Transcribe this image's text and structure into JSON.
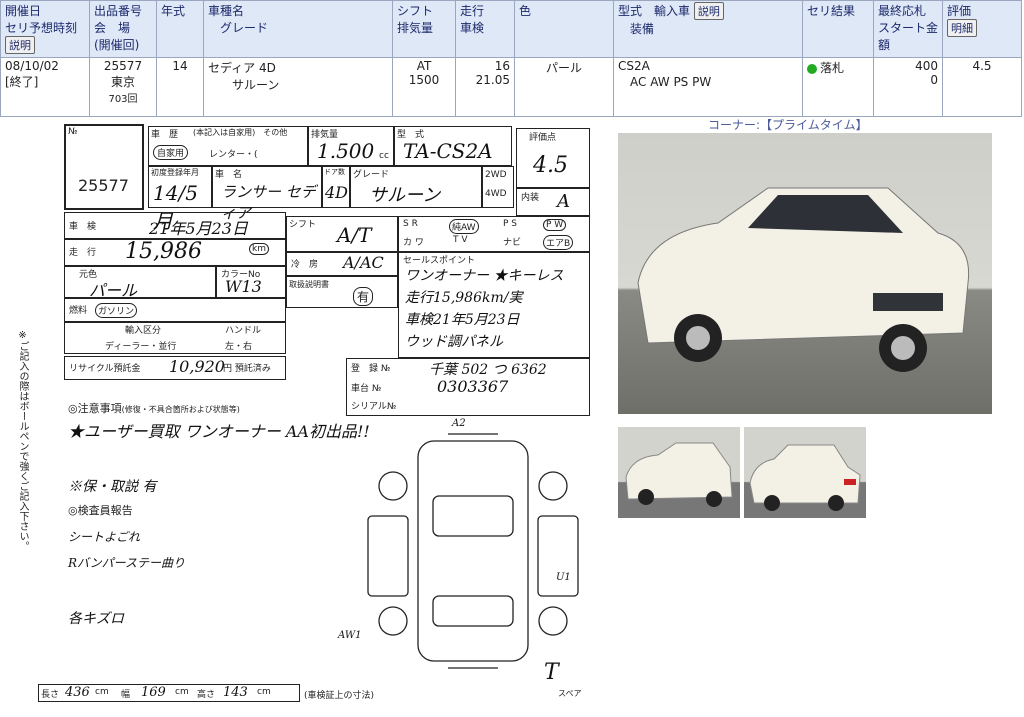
{
  "header": {
    "cols": [
      {
        "l1": "開催日",
        "l2": "セリ予想時刻",
        "btn": "説明"
      },
      {
        "l1": "出品番号",
        "l2": "会　場",
        "l3": "(開催回)"
      },
      {
        "l1": "年式"
      },
      {
        "l1": "車種名",
        "l2": "グレード"
      },
      {
        "l1": "シフト",
        "l2": "排気量"
      },
      {
        "l1": "走行",
        "l2": "車検"
      },
      {
        "l1": "色"
      },
      {
        "l1": "型式　輸入車",
        "btn": "説明",
        "l2": "装備"
      },
      {
        "l1": "セリ結果"
      },
      {
        "l1": "最終応札",
        "l2": "スタート金額"
      },
      {
        "l1": "評価",
        "btn": "明細"
      }
    ],
    "row": {
      "date": "08/10/02",
      "status": "[終了]",
      "lot": "25577",
      "venue": "東京",
      "session": "703回",
      "year": "14",
      "model": "セディア 4D",
      "grade": "サルーン",
      "shift": "AT",
      "cc": "1500",
      "mileage": "16",
      "inspection": "21.05",
      "color": "パール",
      "type": "CS2A",
      "equip": "AC AW PS PW",
      "result": "落札",
      "final": "400",
      "start": "0",
      "grade_score": "4.5"
    }
  },
  "corner_label": "コーナー:【プライムタイム】",
  "sheet": {
    "lot_label": "№",
    "lot": "25577",
    "history": "車　歴",
    "history_sub": "(本記入は自家用)　その他",
    "history_val": "自家用",
    "rental": "レンター・(",
    "cc_label": "排気量",
    "cc_val": "1.500",
    "cc_note": "cc",
    "type_label": "型　式",
    "type_val": "TA-CS2A",
    "score_label": "評価点",
    "score_val": "4.5",
    "first_reg": "初度登録年月",
    "first_reg_val": "14/5月",
    "name_label": "車　名",
    "name_val": "ランサー セディア",
    "door_label": "ドア数",
    "door_val": "4D",
    "grade_label": "グレード",
    "grade_val": "サルーン",
    "drive": "2WD",
    "drive2": "4WD",
    "interior_label": "内装",
    "interior_val": "A",
    "shaken": "車　検",
    "shaken_val": "21年5月23日",
    "odo": "走　行",
    "odo_val": "15,986",
    "odo_unit": "km",
    "shift_label": "シフト",
    "shift_val": "A/T",
    "equip_row1": [
      "S R",
      "純AW",
      "P S",
      "P W"
    ],
    "equip_row2": [
      "カ ワ",
      "T V",
      "ナビ",
      "エアB"
    ],
    "ac_label": "冷　房",
    "ac_val": "A/AC",
    "color_label": "元色",
    "color_val": "パール",
    "colorno_label": "カラーNo",
    "colorno_val": "W13",
    "fuel_label": "燃料",
    "fuel_val": "ガソリン",
    "manual_label": "取扱説明書",
    "manual_val": "有",
    "import_label": "輸入区分",
    "handle_label": "ハンドル",
    "import_val": "ディーラー・並行",
    "handle_val": "左・右",
    "recycle_label": "リサイクル預託金",
    "recycle_val": "10,920",
    "recycle_unit": "円 預託済み",
    "points_label": "セールスポイント",
    "points": [
      "ワンオーナー ★キーレス",
      "走行15,986km/実",
      "車検21年5月23日",
      "ウッド調パネル"
    ],
    "reg_label": "登　録 №",
    "reg_val": "千葉 502 つ 6362",
    "chassis_label": "車台 №",
    "chassis_val": "0303367",
    "serial_label": "シリアル№",
    "notes_label": "◎注意事項",
    "notes_sub": "(修復・不具合箇所および状態等)",
    "note1": "★ユーザー買取 ワンオーナー AA初出品!!",
    "note2": "※保・取説 有",
    "inspector_label": "◎検査員報告",
    "ins1": "シートよごれ",
    "ins2": "Rバンパーステー曲り",
    "ins3": "各キズロ",
    "vertical": "※ご記入の際はボールペンで強くご記入下さい。",
    "size_label": "長さ",
    "size_l": "436",
    "w_label": "幅",
    "size_w": "169",
    "h_label": "高さ",
    "size_h": "143",
    "size_unit": "cm",
    "size_note": "(車検証上の寸法)",
    "diag_a2": "A2",
    "diag_u1": "U1",
    "diag_aw": "AW1",
    "spare": "T",
    "spare_note": "スペア"
  },
  "colors": {
    "header_bg": "#dfe8f7",
    "accent": "#1d2a6b",
    "sold": "#22aa22"
  }
}
